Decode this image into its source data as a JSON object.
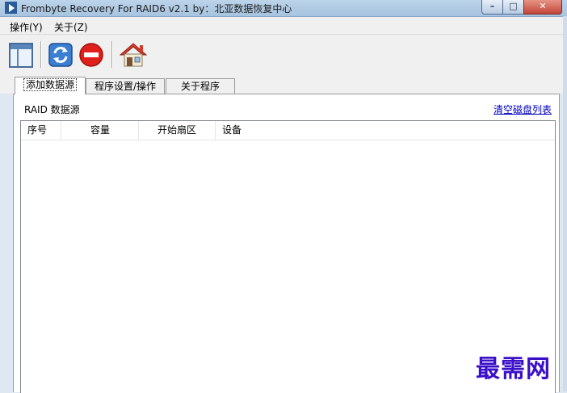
{
  "window": {
    "title": "Frombyte Recovery For RAID6 v2.1 by：北亚数据恢复中心",
    "minimize_glyph": "–",
    "maximize_glyph": "□",
    "close_glyph": "✕"
  },
  "menu": {
    "items": [
      {
        "label": "操作(Y)"
      },
      {
        "label": "关于(Z)"
      }
    ]
  },
  "toolbar": {
    "icons": [
      "view-layout-icon",
      "refresh-icon",
      "stop-icon",
      "home-icon"
    ]
  },
  "tabs": [
    {
      "label": "添加数据源",
      "active": true
    },
    {
      "label": "程序设置/操作",
      "active": false
    },
    {
      "label": "关于程序",
      "active": false
    }
  ],
  "panel": {
    "section_label": "RAID 数据源",
    "clear_link": "清空磁盘列表"
  },
  "disk_list": {
    "columns": [
      "序号",
      "容量",
      "开始扇区",
      "设备"
    ],
    "rows": []
  },
  "watermark": "最需网",
  "colors": {
    "link": "#0000c0",
    "watermark": "#3a0fc8",
    "close_button": "#c3463a"
  }
}
